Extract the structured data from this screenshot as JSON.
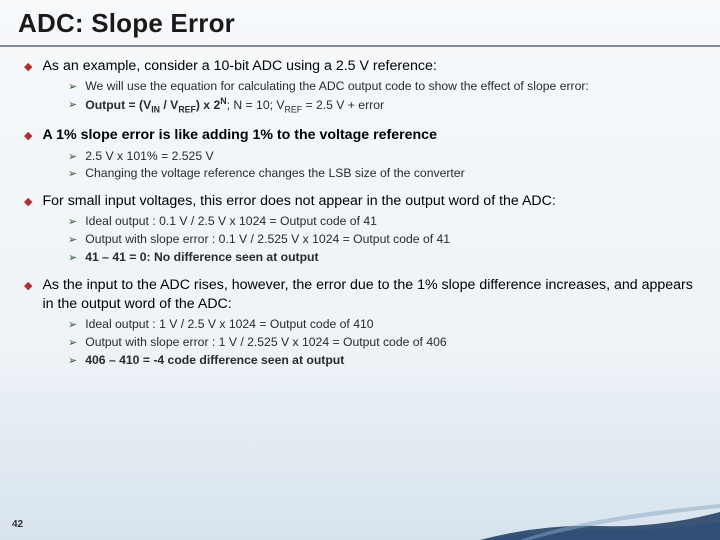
{
  "title": "ADC: Slope Error",
  "sections": [
    {
      "main": "As an example, consider a 10-bit ADC using a 2.5 V reference:",
      "subs": [
        "We will use the equation for calculating the ADC output code to show the effect of slope error:",
        "__FORMULA_1__"
      ]
    },
    {
      "main": "A 1% slope error is like adding 1% to the voltage reference",
      "main_bold": true,
      "subs": [
        "2.5 V x 101% = 2.525 V",
        "Changing the voltage reference changes the LSB size of the converter"
      ]
    },
    {
      "main": "For small input voltages, this error does not appear in the output word of the ADC:",
      "subs": [
        "Ideal output : 0.1 V / 2.5 V x 1024 = Output code of 41",
        "Output with slope error : 0.1 V / 2.525 V x 1024 = Output code of 41",
        "__BOLD__41 – 41 = 0: No difference seen at output"
      ]
    },
    {
      "main": "As the input to the ADC rises, however, the error due to the 1% slope difference increases, and appears in the output word of the ADC:",
      "subs": [
        "Ideal output : 1 V / 2.5 V x 1024 = Output code of 410",
        "Output with slope error : 1 V / 2.525 V x 1024 = Output code of 406",
        "__BOLD__406 – 410 = -4 code difference seen at output"
      ]
    }
  ],
  "formula": {
    "prefix": "Output = (V",
    "in": "IN",
    "mid1": " / V",
    "ref1": "REF",
    "mid2": ") x 2",
    "n": "N",
    "mid3": "; N = 10; V",
    "ref2": "REF",
    "suffix": " = 2.5 V + error"
  },
  "page": "42"
}
